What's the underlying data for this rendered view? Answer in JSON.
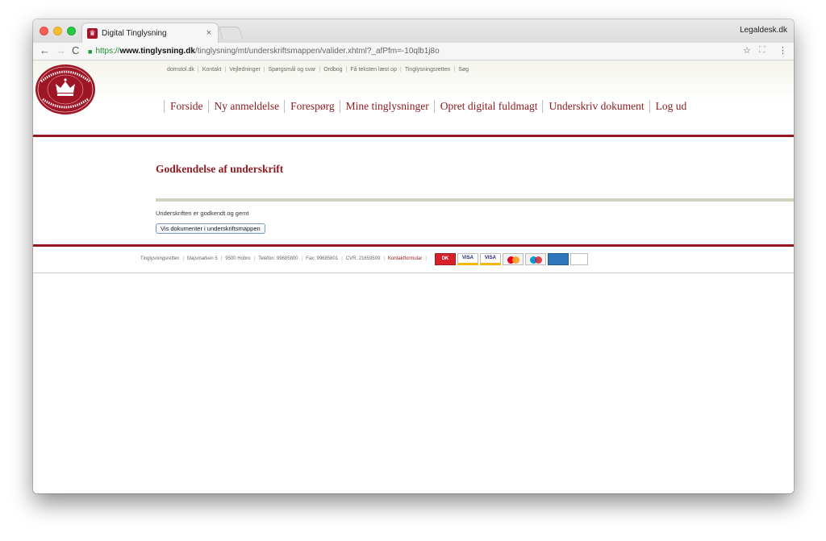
{
  "browser": {
    "tab_title": "Digital Tinglysning",
    "tab_close": "×",
    "profile_name": "Legaldesk.dk",
    "url_scheme": "https://",
    "url_host": "www.tinglysning.dk",
    "url_path": "/tinglysning/mt/underskriftsmappen/valider.xhtml?_afPfm=-10qlb1j8o"
  },
  "icons": {
    "back": "←",
    "forward": "→",
    "reload": "C",
    "lock": "🔒",
    "star": "☆",
    "extension": "⛶",
    "menu": "⋮"
  },
  "top_links": [
    "domstol.dk",
    "Kontakt",
    "Vejledninger",
    "Spørgsmål og svar",
    "Ordbog",
    "Få teksten læst op",
    "Tinglysningsretten",
    "Søg"
  ],
  "logo": {
    "top_text": "TINGLYSNINGSRETTEN",
    "bottom_text": "DANMARKS DOMSTOLE"
  },
  "main_nav": [
    "Forside",
    "Ny anmeldelse",
    "Forespørg",
    "Mine tinglysninger",
    "Opret digital fuldmagt",
    "Underskriv dokument",
    "Log ud"
  ],
  "content": {
    "title": "Godkendelse af underskrift",
    "status_text": "Underskriften er godkendt og gemt",
    "button_label": "Vis dokumenter i underskriftsmappen"
  },
  "footer": {
    "items": [
      "Tinglysningsretten",
      "Majsmarken 5",
      "9500 Hobro",
      "Telefon: 99685800",
      "Fax: 99685801",
      "CVR: 21659509"
    ],
    "contact_link": "Kontaktformular",
    "cards": [
      "DK",
      "VISA",
      "VISA",
      "",
      "",
      "",
      ""
    ]
  },
  "colors": {
    "brand_red": "#8c1a1e",
    "rule_red": "#941722",
    "beige_bar": "#d5d1c1"
  }
}
